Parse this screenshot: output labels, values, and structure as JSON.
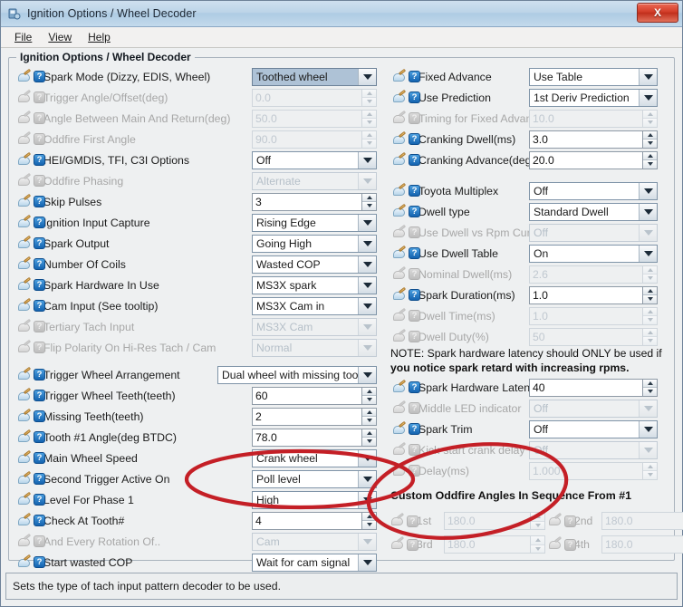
{
  "window": {
    "title": "Ignition Options / Wheel Decoder",
    "close_label": "X",
    "icon": "app-icon"
  },
  "menubar": {
    "items": [
      {
        "label": "File"
      },
      {
        "label": "View"
      },
      {
        "label": "Help"
      }
    ]
  },
  "panel": {
    "title": "Ignition Options / Wheel Decoder"
  },
  "left_column": {
    "rows": [
      {
        "label": "Spark Mode (Dizzy, EDIS, Wheel)",
        "value": "Toothed wheel",
        "type": "combo",
        "enabled": true,
        "selected": true
      },
      {
        "label": "Trigger Angle/Offset(deg)",
        "value": "0.0",
        "type": "spin",
        "enabled": false
      },
      {
        "label": "Angle Between Main And Return(deg)",
        "value": "50.0",
        "type": "spin",
        "enabled": false
      },
      {
        "label": "Oddfire First Angle",
        "value": "90.0",
        "type": "spin",
        "enabled": false
      },
      {
        "label": "HEI/GMDIS, TFI, C3I Options",
        "value": "Off",
        "type": "combo",
        "enabled": true
      },
      {
        "label": "Oddfire Phasing",
        "value": "Alternate",
        "type": "combo",
        "enabled": false
      },
      {
        "label": "Skip Pulses",
        "value": "3",
        "type": "spin",
        "enabled": true
      },
      {
        "label": "Ignition Input Capture",
        "value": "Rising Edge",
        "type": "combo",
        "enabled": true
      },
      {
        "label": "Spark Output",
        "value": "Going High",
        "type": "combo",
        "enabled": true
      },
      {
        "label": "Number Of Coils",
        "value": "Wasted COP",
        "type": "combo",
        "enabled": true
      },
      {
        "label": "Spark Hardware In Use",
        "value": "MS3X spark",
        "type": "combo",
        "enabled": true
      },
      {
        "label": "Cam Input (See tooltip)",
        "value": "MS3X Cam in",
        "type": "combo",
        "enabled": true
      },
      {
        "label": "Tertiary Tach Input",
        "value": "MS3X Cam",
        "type": "combo",
        "enabled": false
      },
      {
        "label": "Flip Polarity On Hi-Res Tach / Cam",
        "value": "Normal",
        "type": "combo",
        "enabled": false
      },
      {
        "label": "Trigger Wheel Arrangement",
        "value": "Dual wheel with missing tooth",
        "type": "combo",
        "enabled": true,
        "wide": true
      },
      {
        "label": "Trigger Wheel Teeth(teeth)",
        "value": "60",
        "type": "spin",
        "enabled": true
      },
      {
        "label": "Missing Teeth(teeth)",
        "value": "2",
        "type": "spin",
        "enabled": true
      },
      {
        "label": "Tooth #1 Angle(deg BTDC)",
        "value": "78.0",
        "type": "spin",
        "enabled": true
      },
      {
        "label": "Main Wheel Speed",
        "value": "Crank wheel",
        "type": "combo",
        "enabled": true
      },
      {
        "label": "Second Trigger Active On",
        "value": "Poll level",
        "type": "combo",
        "enabled": true
      },
      {
        "label": "Level For Phase 1",
        "value": "High",
        "type": "combo",
        "enabled": true
      },
      {
        "label": "Check At Tooth#",
        "value": "4",
        "type": "spin",
        "enabled": true
      },
      {
        "label": "And Every Rotation Of..",
        "value": "Cam",
        "type": "combo",
        "enabled": false
      },
      {
        "label": "Start wasted COP",
        "value": "Wait for cam signal",
        "type": "combo",
        "enabled": true
      }
    ]
  },
  "right_column": {
    "rows_top": [
      {
        "label": "Fixed Advance",
        "value": "Use Table",
        "type": "combo",
        "enabled": true
      },
      {
        "label": "Use Prediction",
        "value": "1st Deriv Prediction",
        "type": "combo",
        "enabled": true
      },
      {
        "label": "Timing for Fixed Advance(degrees)",
        "value": "10.0",
        "type": "spin",
        "enabled": false
      },
      {
        "label": "Cranking Dwell(ms)",
        "value": "3.0",
        "type": "spin",
        "enabled": true
      },
      {
        "label": "Cranking Advance(degrees)",
        "value": "20.0",
        "type": "spin",
        "enabled": true
      }
    ],
    "rows_mid": [
      {
        "label": "Toyota Multiplex",
        "value": "Off",
        "type": "combo",
        "enabled": true
      },
      {
        "label": "Dwell type",
        "value": "Standard Dwell",
        "type": "combo",
        "enabled": true
      },
      {
        "label": "Use Dwell vs Rpm Curve",
        "value": "Off",
        "type": "combo",
        "enabled": false
      },
      {
        "label": "Use Dwell Table",
        "value": "On",
        "type": "combo",
        "enabled": true
      },
      {
        "label": "Nominal Dwell(ms)",
        "value": "2.6",
        "type": "spin",
        "enabled": false
      },
      {
        "label": "Spark Duration(ms)",
        "value": "1.0",
        "type": "spin",
        "enabled": true
      },
      {
        "label": "Dwell Time(ms)",
        "value": "1.0",
        "type": "spin",
        "enabled": false
      },
      {
        "label": "Dwell Duty(%)",
        "value": "50",
        "type": "spin",
        "enabled": false
      }
    ],
    "note_line1": "NOTE: Spark hardware latency should ONLY be used if",
    "note_line2": "you notice spark retard with increasing rpms.",
    "rows_bottom": [
      {
        "label": "Spark Hardware Latency(usec)",
        "value": "40",
        "type": "spin",
        "enabled": true
      },
      {
        "label": "Middle LED indicator",
        "value": "Off",
        "type": "combo",
        "enabled": false
      },
      {
        "label": "Spark Trim",
        "value": "Off",
        "type": "combo",
        "enabled": true
      },
      {
        "label": "Kick-start crank delay",
        "value": "Off",
        "type": "combo",
        "enabled": false
      },
      {
        "label": "Delay(ms)",
        "value": "1.000",
        "type": "spin",
        "enabled": false
      }
    ],
    "oddfire_heading": "Custom Oddfire Angles In Sequence From #1",
    "oddfire": [
      {
        "label": "1st",
        "value": "180.0",
        "enabled": false
      },
      {
        "label": "2nd",
        "value": "180.0",
        "enabled": false
      },
      {
        "label": "3rd",
        "value": "180.0",
        "enabled": false
      },
      {
        "label": "4th",
        "value": "180.0",
        "enabled": false
      }
    ]
  },
  "statusbar": {
    "text": "Sets the type of tach input pattern decoder to be used."
  },
  "annotations": {
    "color": "#c41f26",
    "shapes": [
      "ellipse-left",
      "ellipse-right"
    ]
  },
  "colors": {
    "title_bar": "#bcd4e8",
    "close_button": "#d33d29",
    "help_icon": "#1463b0",
    "selected_combo": "#aec2d6",
    "annotation_red": "#c41f26"
  }
}
